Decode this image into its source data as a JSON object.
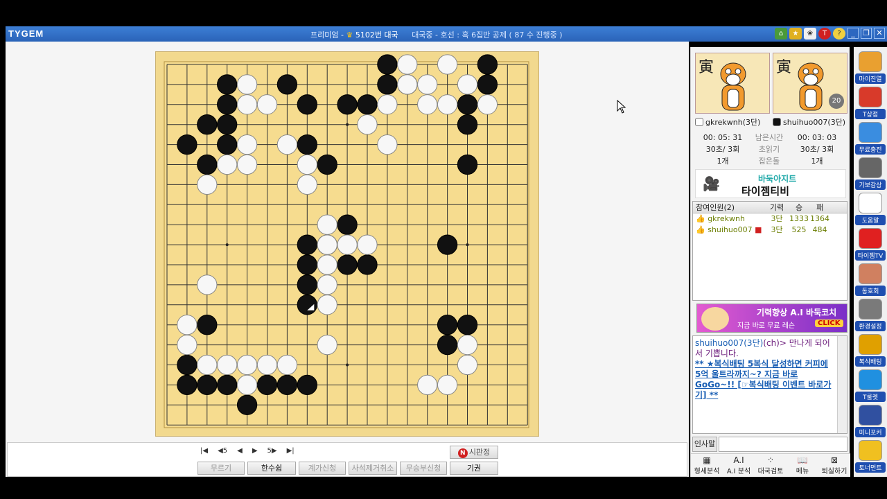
{
  "window": {
    "logo": "TYGEM",
    "title_prefix": "프리미엄 - ",
    "game": "5102번 대국",
    "status": "대국중 - 호선 : 흑 6집반 공제 ( 87 수 진행중 )"
  },
  "players": {
    "white": {
      "name": "gkrekwnh(3단)",
      "time": "00: 05: 31",
      "byoyomi": "30초/ 3회",
      "captured": "1개"
    },
    "black": {
      "name": "shuihuo007(3단)",
      "time": "00: 03: 03",
      "byoyomi": "30초/ 3회",
      "captured": "1개"
    },
    "labels": {
      "remaining": "남은시간",
      "byoyomi": "초읽기",
      "captured": "잡은돌"
    },
    "avatar_glyph": "寅",
    "badge": "20"
  },
  "banner_top": {
    "line1": "바둑아지트",
    "line2": "타이젬티비"
  },
  "roster": {
    "headers": [
      "참여인원(2)",
      "기력",
      "승",
      "패"
    ],
    "rows": [
      {
        "name": "gkrekwnh",
        "rank": "3단",
        "win": "1333",
        "loss": "1364"
      },
      {
        "name": "shuihuo007",
        "rank": "3단",
        "win": "525",
        "loss": "484"
      }
    ]
  },
  "banner_ai": {
    "line1": "기력향상 A.I 바둑코치",
    "line2": "지금 바로 무료 레슨",
    "cta": "CLICK"
  },
  "chat": {
    "line1_who": "shuihuo007(3단)",
    "line1_msg": "(ch)> 만나게 되어서 기쁩니다.",
    "ad": "** ★복식배팅 5복식 달성하면 커피에 5억 울트라까지~? 지금 바로 GoGo~!! [☞복식배팅 이벤트 바로가기] **"
  },
  "input_label": "인사말",
  "bottom_tools": [
    {
      "icon": "grid-icon",
      "label": "형세분석",
      "glyph": "▦"
    },
    {
      "icon": "ai-icon",
      "label": "A.I 분석",
      "glyph": "A.I"
    },
    {
      "icon": "stones-icon",
      "label": "대국검토",
      "glyph": "⁘"
    },
    {
      "icon": "book-icon",
      "label": "메뉴",
      "glyph": "📖"
    },
    {
      "icon": "exit-icon",
      "label": "퇴실하기",
      "glyph": "⊠"
    }
  ],
  "nav": {
    "first": "|◀",
    "back5": "◀5",
    "prev": "◀",
    "next": "▶",
    "fwd5": "5▶",
    "last": "▶|"
  },
  "buttons": {
    "undo": "무르기",
    "pass": "한수쉼",
    "count": "계가신청",
    "dead_remove": "사석제거취소",
    "draw": "무승부신청",
    "judge": "시판정",
    "resign": "기권"
  },
  "rail": [
    {
      "icon": "my-room-icon",
      "label": "마이진열",
      "color": "#e9a030"
    },
    {
      "icon": "t-shop-icon",
      "label": "T상점",
      "color": "#d83a2a"
    },
    {
      "icon": "free-charge-icon",
      "label": "무료충전",
      "color": "#3a8de0"
    },
    {
      "icon": "record-icon",
      "label": "기보감상",
      "color": "#666666"
    },
    {
      "icon": "help-icon",
      "label": "도움말",
      "color": "#ffffff"
    },
    {
      "icon": "tygem-tv-icon",
      "label": "타이젬TV",
      "color": "#e02020"
    },
    {
      "icon": "friends-icon",
      "label": "동호회",
      "color": "#d08060"
    },
    {
      "icon": "settings-icon",
      "label": "환경설정",
      "color": "#7a7a7a"
    },
    {
      "icon": "betting-icon",
      "label": "복식배팅",
      "color": "#e0a000"
    },
    {
      "icon": "t-roulette-icon",
      "label": "T룰렛",
      "color": "#2090e0"
    },
    {
      "icon": "mini-game-icon",
      "label": "미니포커",
      "color": "#3050a0"
    },
    {
      "icon": "tournament-icon",
      "label": "토너먼트",
      "color": "#f0c020"
    }
  ],
  "board": {
    "size": 19,
    "black": [
      [
        11,
        0
      ],
      [
        16,
        0
      ],
      [
        11,
        1
      ],
      [
        12,
        1
      ],
      [
        16,
        1
      ],
      [
        3,
        1
      ],
      [
        6,
        1
      ],
      [
        3,
        2
      ],
      [
        7,
        2
      ],
      [
        9,
        2
      ],
      [
        10,
        2
      ],
      [
        15,
        2
      ],
      [
        2,
        3
      ],
      [
        3,
        3
      ],
      [
        15,
        3
      ],
      [
        1,
        4
      ],
      [
        3,
        4
      ],
      [
        7,
        4
      ],
      [
        2,
        5
      ],
      [
        8,
        5
      ],
      [
        15,
        5
      ],
      [
        9,
        8
      ],
      [
        7,
        9
      ],
      [
        8,
        9
      ],
      [
        14,
        9
      ],
      [
        7,
        10
      ],
      [
        9,
        10
      ],
      [
        10,
        10
      ],
      [
        7,
        11
      ],
      [
        7,
        12
      ],
      [
        2,
        13
      ],
      [
        14,
        13
      ],
      [
        15,
        13
      ],
      [
        14,
        14
      ],
      [
        1,
        15
      ],
      [
        1,
        16
      ],
      [
        2,
        16
      ],
      [
        3,
        16
      ],
      [
        5,
        16
      ],
      [
        6,
        16
      ],
      [
        7,
        16
      ],
      [
        4,
        17
      ]
    ],
    "white": [
      [
        12,
        0
      ],
      [
        14,
        0
      ],
      [
        4,
        1
      ],
      [
        12,
        1
      ],
      [
        13,
        1
      ],
      [
        15,
        1
      ],
      [
        4,
        2
      ],
      [
        5,
        2
      ],
      [
        11,
        2
      ],
      [
        13,
        2
      ],
      [
        14,
        2
      ],
      [
        16,
        2
      ],
      [
        10,
        3
      ],
      [
        4,
        4
      ],
      [
        6,
        4
      ],
      [
        11,
        4
      ],
      [
        3,
        5
      ],
      [
        4,
        5
      ],
      [
        7,
        5
      ],
      [
        2,
        6
      ],
      [
        7,
        6
      ],
      [
        8,
        8
      ],
      [
        8,
        9
      ],
      [
        9,
        9
      ],
      [
        10,
        9
      ],
      [
        8,
        10
      ],
      [
        2,
        11
      ],
      [
        8,
        11
      ],
      [
        8,
        12
      ],
      [
        1,
        13
      ],
      [
        1,
        14
      ],
      [
        8,
        14
      ],
      [
        15,
        14
      ],
      [
        2,
        15
      ],
      [
        3,
        15
      ],
      [
        4,
        15
      ],
      [
        5,
        15
      ],
      [
        6,
        15
      ],
      [
        15,
        15
      ],
      [
        4,
        16
      ],
      [
        13,
        16
      ],
      [
        14,
        16
      ]
    ],
    "last_move": [
      7,
      12
    ]
  }
}
